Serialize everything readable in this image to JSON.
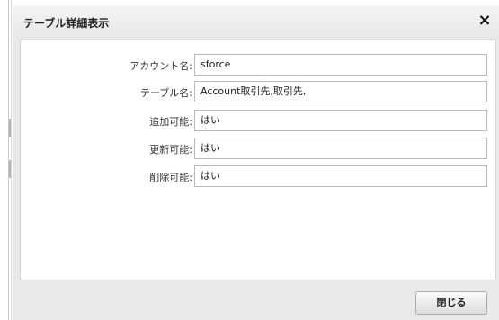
{
  "dialog": {
    "title": "テーブル詳細表示",
    "close_icon": "×",
    "close_button_label": "閉じる"
  },
  "fields": [
    {
      "label": "アカウント名:",
      "value": "sforce"
    },
    {
      "label": "テーブル名:",
      "value": "Account取引先,取引先,"
    },
    {
      "label": "追加可能:",
      "value": "はい"
    },
    {
      "label": "更新可能:",
      "value": "はい"
    },
    {
      "label": "削除可能:",
      "value": "はい"
    }
  ]
}
